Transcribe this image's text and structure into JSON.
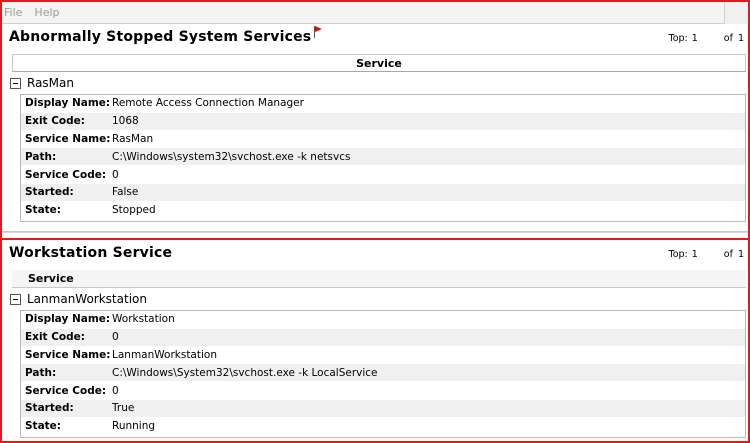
{
  "menu": {
    "file": "File",
    "help": "Help"
  },
  "sections": [
    {
      "title": "Abnormally Stopped System Services",
      "top_label": "Top:",
      "top_value": "1",
      "of_label": "of",
      "of_value": "1",
      "column_header": "Service",
      "group": "RasMan",
      "fields": [
        {
          "label": "Display Name:",
          "value": "Remote Access Connection Manager"
        },
        {
          "label": "Exit Code:",
          "value": "1068"
        },
        {
          "label": "Service Name:",
          "value": "RasMan"
        },
        {
          "label": "Path:",
          "value": "C:\\Windows\\system32\\svchost.exe -k netsvcs"
        },
        {
          "label": "Service Code:",
          "value": "0"
        },
        {
          "label": "Started:",
          "value": "False"
        },
        {
          "label": "State:",
          "value": "Stopped"
        }
      ]
    },
    {
      "title": "Workstation Service",
      "top_label": "Top:",
      "top_value": "1",
      "of_label": "of",
      "of_value": "1",
      "column_header": "Service",
      "group": "LanmanWorkstation",
      "fields": [
        {
          "label": "Display Name:",
          "value": "Workstation"
        },
        {
          "label": "Exit Code:",
          "value": "0"
        },
        {
          "label": "Service Name:",
          "value": "LanmanWorkstation"
        },
        {
          "label": "Path:",
          "value": "C:\\Windows\\System32\\svchost.exe -k LocalService"
        },
        {
          "label": "Service Code:",
          "value": "0"
        },
        {
          "label": "Started:",
          "value": "True"
        },
        {
          "label": "State:",
          "value": "Running"
        }
      ]
    }
  ],
  "colors": {
    "frame": "#e01b1b",
    "flag": "#d41010",
    "menu_text": "#9a9a9a",
    "alt_row": "#f0f0f0"
  }
}
